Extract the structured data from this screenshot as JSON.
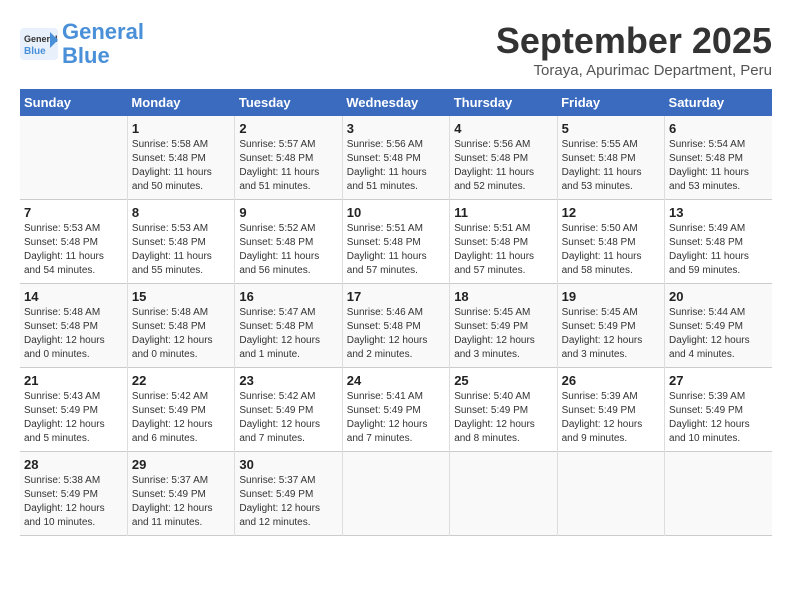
{
  "header": {
    "logo_line1": "General",
    "logo_line2": "Blue",
    "month": "September 2025",
    "location": "Toraya, Apurimac Department, Peru"
  },
  "days_of_week": [
    "Sunday",
    "Monday",
    "Tuesday",
    "Wednesday",
    "Thursday",
    "Friday",
    "Saturday"
  ],
  "weeks": [
    [
      {
        "day": "",
        "info": ""
      },
      {
        "day": "1",
        "info": "Sunrise: 5:58 AM\nSunset: 5:48 PM\nDaylight: 11 hours\nand 50 minutes."
      },
      {
        "day": "2",
        "info": "Sunrise: 5:57 AM\nSunset: 5:48 PM\nDaylight: 11 hours\nand 51 minutes."
      },
      {
        "day": "3",
        "info": "Sunrise: 5:56 AM\nSunset: 5:48 PM\nDaylight: 11 hours\nand 51 minutes."
      },
      {
        "day": "4",
        "info": "Sunrise: 5:56 AM\nSunset: 5:48 PM\nDaylight: 11 hours\nand 52 minutes."
      },
      {
        "day": "5",
        "info": "Sunrise: 5:55 AM\nSunset: 5:48 PM\nDaylight: 11 hours\nand 53 minutes."
      },
      {
        "day": "6",
        "info": "Sunrise: 5:54 AM\nSunset: 5:48 PM\nDaylight: 11 hours\nand 53 minutes."
      }
    ],
    [
      {
        "day": "7",
        "info": "Sunrise: 5:53 AM\nSunset: 5:48 PM\nDaylight: 11 hours\nand 54 minutes."
      },
      {
        "day": "8",
        "info": "Sunrise: 5:53 AM\nSunset: 5:48 PM\nDaylight: 11 hours\nand 55 minutes."
      },
      {
        "day": "9",
        "info": "Sunrise: 5:52 AM\nSunset: 5:48 PM\nDaylight: 11 hours\nand 56 minutes."
      },
      {
        "day": "10",
        "info": "Sunrise: 5:51 AM\nSunset: 5:48 PM\nDaylight: 11 hours\nand 57 minutes."
      },
      {
        "day": "11",
        "info": "Sunrise: 5:51 AM\nSunset: 5:48 PM\nDaylight: 11 hours\nand 57 minutes."
      },
      {
        "day": "12",
        "info": "Sunrise: 5:50 AM\nSunset: 5:48 PM\nDaylight: 11 hours\nand 58 minutes."
      },
      {
        "day": "13",
        "info": "Sunrise: 5:49 AM\nSunset: 5:48 PM\nDaylight: 11 hours\nand 59 minutes."
      }
    ],
    [
      {
        "day": "14",
        "info": "Sunrise: 5:48 AM\nSunset: 5:48 PM\nDaylight: 12 hours\nand 0 minutes."
      },
      {
        "day": "15",
        "info": "Sunrise: 5:48 AM\nSunset: 5:48 PM\nDaylight: 12 hours\nand 0 minutes."
      },
      {
        "day": "16",
        "info": "Sunrise: 5:47 AM\nSunset: 5:48 PM\nDaylight: 12 hours\nand 1 minute."
      },
      {
        "day": "17",
        "info": "Sunrise: 5:46 AM\nSunset: 5:48 PM\nDaylight: 12 hours\nand 2 minutes."
      },
      {
        "day": "18",
        "info": "Sunrise: 5:45 AM\nSunset: 5:49 PM\nDaylight: 12 hours\nand 3 minutes."
      },
      {
        "day": "19",
        "info": "Sunrise: 5:45 AM\nSunset: 5:49 PM\nDaylight: 12 hours\nand 3 minutes."
      },
      {
        "day": "20",
        "info": "Sunrise: 5:44 AM\nSunset: 5:49 PM\nDaylight: 12 hours\nand 4 minutes."
      }
    ],
    [
      {
        "day": "21",
        "info": "Sunrise: 5:43 AM\nSunset: 5:49 PM\nDaylight: 12 hours\nand 5 minutes."
      },
      {
        "day": "22",
        "info": "Sunrise: 5:42 AM\nSunset: 5:49 PM\nDaylight: 12 hours\nand 6 minutes."
      },
      {
        "day": "23",
        "info": "Sunrise: 5:42 AM\nSunset: 5:49 PM\nDaylight: 12 hours\nand 7 minutes."
      },
      {
        "day": "24",
        "info": "Sunrise: 5:41 AM\nSunset: 5:49 PM\nDaylight: 12 hours\nand 7 minutes."
      },
      {
        "day": "25",
        "info": "Sunrise: 5:40 AM\nSunset: 5:49 PM\nDaylight: 12 hours\nand 8 minutes."
      },
      {
        "day": "26",
        "info": "Sunrise: 5:39 AM\nSunset: 5:49 PM\nDaylight: 12 hours\nand 9 minutes."
      },
      {
        "day": "27",
        "info": "Sunrise: 5:39 AM\nSunset: 5:49 PM\nDaylight: 12 hours\nand 10 minutes."
      }
    ],
    [
      {
        "day": "28",
        "info": "Sunrise: 5:38 AM\nSunset: 5:49 PM\nDaylight: 12 hours\nand 10 minutes."
      },
      {
        "day": "29",
        "info": "Sunrise: 5:37 AM\nSunset: 5:49 PM\nDaylight: 12 hours\nand 11 minutes."
      },
      {
        "day": "30",
        "info": "Sunrise: 5:37 AM\nSunset: 5:49 PM\nDaylight: 12 hours\nand 12 minutes."
      },
      {
        "day": "",
        "info": ""
      },
      {
        "day": "",
        "info": ""
      },
      {
        "day": "",
        "info": ""
      },
      {
        "day": "",
        "info": ""
      }
    ]
  ]
}
